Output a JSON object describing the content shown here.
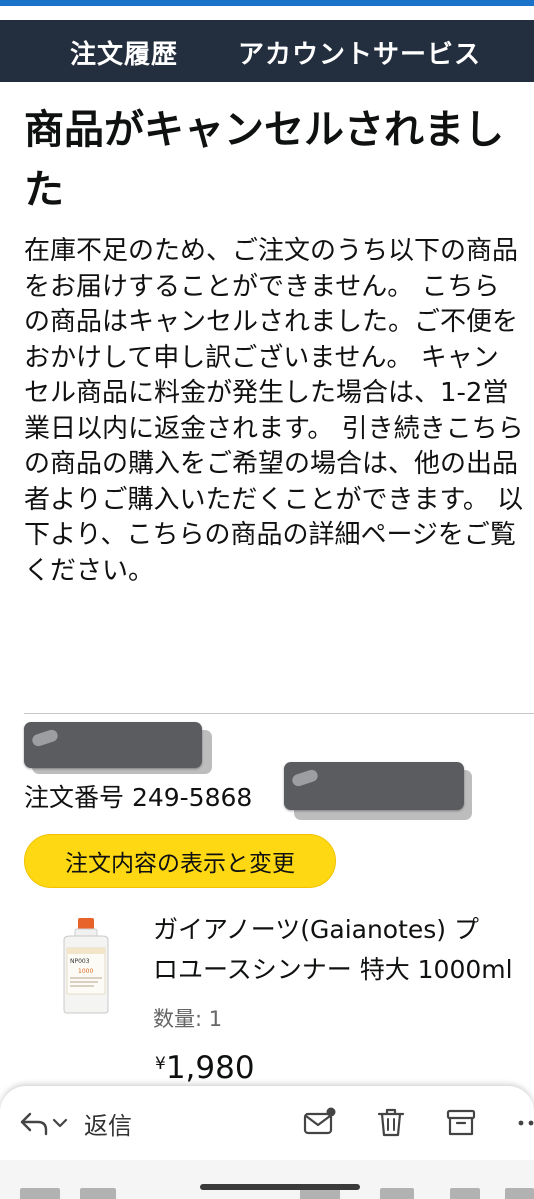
{
  "nav": {
    "orders": "注文履歴",
    "account_services": "アカウントサービス"
  },
  "message": {
    "headline": "商品がキャンセルされました",
    "body": "在庫不足のため、ご注文のうち以下の商品をお届けすることができません。 こちらの商品はキャンセルされました。ご不便をおかけして申し訳ございません。 キャンセル商品に料金が発生した場合は、1-2営業日以内に返金されます。 引き続きこちらの商品の購入をご希望の場合は、他の出品者よりご購入いただくことができます。 以下より、こちらの商品の詳細ページをご覧ください。"
  },
  "order": {
    "number_label": "注文番号 249-5868",
    "view_button": "注文内容の表示と変更"
  },
  "product": {
    "title_line1": "ガイアノーツ(Gaianotes) プ",
    "title_line2": "ロユースシンナー 特大 1000ml",
    "label_brand": "NP003",
    "label_volume": "1000",
    "quantity": "数量: 1",
    "price_symbol": "¥",
    "price": "1,980"
  },
  "action_bar": {
    "reply": "返信",
    "icons": [
      "reply-icon",
      "mark-unread-icon",
      "delete-icon",
      "archive-icon",
      "more-icon"
    ]
  },
  "colors": {
    "nav_bg": "#232f3e",
    "accent_top": "#1a73c9",
    "button_yellow": "#ffd814",
    "redaction": "#5a5c5f"
  }
}
